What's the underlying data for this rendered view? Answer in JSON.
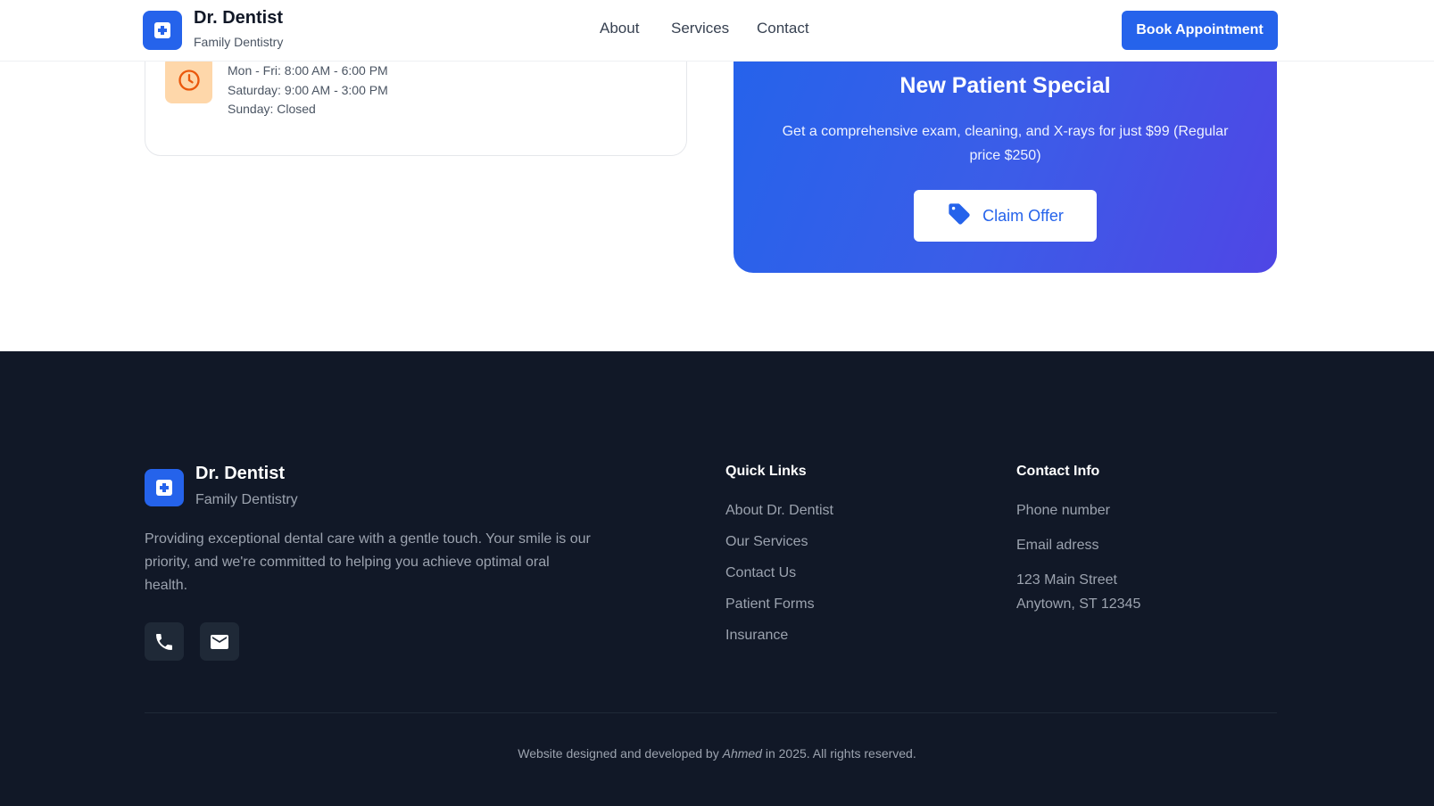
{
  "header": {
    "brand_name": "Dr. Dentist",
    "brand_tagline": "Family Dentistry",
    "nav": [
      "About",
      "Services",
      "Contact"
    ],
    "cta_label": "Book Appointment",
    "logo_icon": "medical-cross-icon"
  },
  "hours": {
    "icon": "clock-icon",
    "lines": [
      "Mon - Fri: 8:00 AM - 6:00 PM",
      "Saturday: 9:00 AM - 3:00 PM",
      "Sunday: Closed"
    ]
  },
  "special": {
    "title": "New Patient Special",
    "description": "Get a comprehensive exam, cleaning, and X-rays for just $99 (Regular price $250)",
    "button_label": "Claim Offer",
    "button_icon": "tag-icon"
  },
  "footer": {
    "brand_name": "Dr. Dentist",
    "brand_tagline": "Family Dentistry",
    "description": "Providing exceptional dental care with a gentle touch. Your smile is our priority, and we're committed to helping you achieve optimal oral health.",
    "social_icons": [
      "phone-icon",
      "mail-icon"
    ],
    "quick_links_heading": "Quick Links",
    "quick_links": [
      "About Dr. Dentist",
      "Our Services",
      "Contact Us",
      "Patient Forms",
      "Insurance"
    ],
    "contact_heading": "Contact Info",
    "contact": {
      "phone": "Phone number",
      "email": "Email adress",
      "address_line1": "123 Main Street",
      "address_line2": "Anytown, ST 12345"
    },
    "copyright_prefix": "Website designed and developed by",
    "copyright_author": "Ahmed",
    "copyright_suffix": "in 2025. All rights reserved."
  },
  "colors": {
    "primary": "#2563eb",
    "footer_bg": "#111827",
    "clock_bg": "#fed7aa",
    "clock_fg": "#ea580c"
  }
}
